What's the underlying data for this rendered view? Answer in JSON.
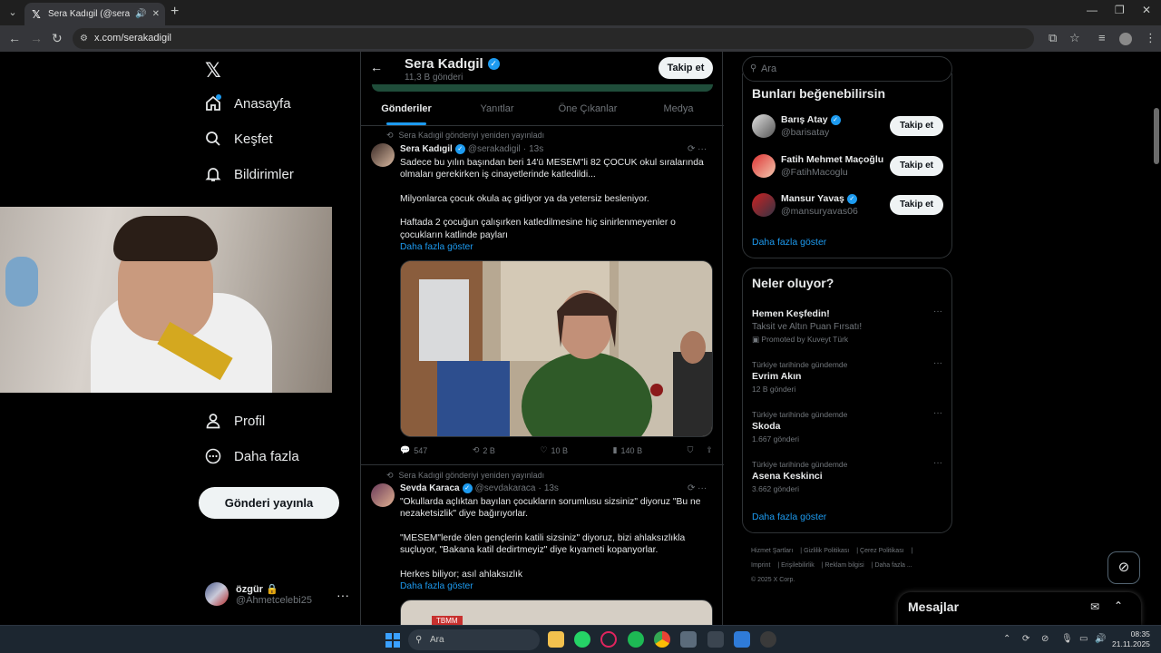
{
  "browser": {
    "tab_title": "Sera Kadıgil (@serakadigil) / X",
    "url": "x.com/serakadigil"
  },
  "leftnav": {
    "items": [
      {
        "label": "Anasayfa",
        "icon": "home-icon"
      },
      {
        "label": "Keşfet",
        "icon": "search-icon"
      },
      {
        "label": "Bildirimler",
        "icon": "bell-icon"
      },
      {
        "label": "Profil",
        "icon": "person-icon"
      },
      {
        "label": "Daha fazla",
        "icon": "more-circle-icon"
      }
    ],
    "post_button": "Gönderi yayınla",
    "account": {
      "name": "özgür",
      "handle": "@Ahmetcelebi25"
    }
  },
  "profile": {
    "name": "Sera Kadıgil",
    "post_count": "11,3 B gönderi",
    "follow_label": "Takip et",
    "tabs": [
      "Gönderiler",
      "Yanıtlar",
      "Öne Çıkanlar",
      "Medya"
    ],
    "active_tab": "Gönderiler"
  },
  "posts": [
    {
      "repost_label": "Sera Kadıgil gönderiyi yeniden yayınladı",
      "author": "Sera Kadıgil",
      "handle": "@serakadigil",
      "time": "13s",
      "text": "Sadece bu yılın başından beri 14'ü MESEM\"li 82 ÇOCUK okul sıralarında olmaları gerekirken iş cinayetlerinde katledildi...\n\nMilyonlarca çocuk okula aç gidiyor ya da yetersiz besleniyor.\n\nHaftada 2 çocuğun çalışırken katledilmesine hiç sinirlenmeyenler o çocukların katlinde payları",
      "show_more": "Daha fazla göster",
      "stats": {
        "replies": "547",
        "reposts": "2 B",
        "likes": "10 B",
        "views": "140 B"
      }
    },
    {
      "repost_label": "Sera Kadıgil gönderiyi yeniden yayınladı",
      "author": "Sevda Karaca",
      "handle": "@sevdakaraca",
      "time": "13s",
      "text": "\"Okullarda açlıktan bayılan çocukların sorumlusu sizsiniz\" diyoruz \"Bu ne nezaketsizlik\" diye bağırıyorlar.\n\n\"MESEM\"lerde ölen gençlerin katili sizsiniz\" diyoruz, bizi ahlaksızlıkla suçluyor, \"Bakana katil dedirtmeyiz\" diye kıyameti kopanyorlar.\n\nHerkes biliyor; asıl ahlaksızlık",
      "show_more": "Daha fazla göster",
      "media_label": "TBMM"
    }
  ],
  "right": {
    "search_placeholder": "Ara",
    "suggest_title": "Bunları beğenebilirsin",
    "suggestions": [
      {
        "name": "Barış Atay",
        "handle": "@barisatay",
        "button": "Takip et"
      },
      {
        "name": "Fatih Mehmet Maçoğlu",
        "handle": "@FatihMacoglu",
        "button": "Takip et"
      },
      {
        "name": "Mansur Yavaş",
        "handle": "@mansuryavas06",
        "button": "Takip et"
      }
    ],
    "suggest_more": "Daha fazla göster",
    "trends_title": "Neler oluyor?",
    "trends": [
      {
        "context": "",
        "title": "Hemen Keşfedin!",
        "sub": "Taksit ve Altın Puan Fırsatı!",
        "count": "Promoted by Kuveyt Türk"
      },
      {
        "context": "Türkiye tarihinde gündemde",
        "title": "Evrim Akın",
        "count": "12 B gönderi"
      },
      {
        "context": "Türkiye tarihinde gündemde",
        "title": "Skoda",
        "count": "1.667 gönderi"
      },
      {
        "context": "Türkiye tarihinde gündemde",
        "title": "Asena Keskinci",
        "count": "3.662 gönderi"
      }
    ],
    "trends_more": "Daha fazla göster",
    "footer": [
      "Hizmet Şartları",
      "Gizlilik Politikası",
      "Çerez Politikası",
      "Imprint",
      "Erişilebilirlik",
      "Reklam bilgisi",
      "Daha fazla ...",
      "© 2025 X Corp."
    ],
    "messages": "Mesajlar"
  },
  "taskbar": {
    "search": "Ara",
    "time": "08:35",
    "date": "21.11.2025"
  },
  "colors": {
    "accent": "#1d9bf0",
    "background": "#000000",
    "border": "#2f3336"
  }
}
